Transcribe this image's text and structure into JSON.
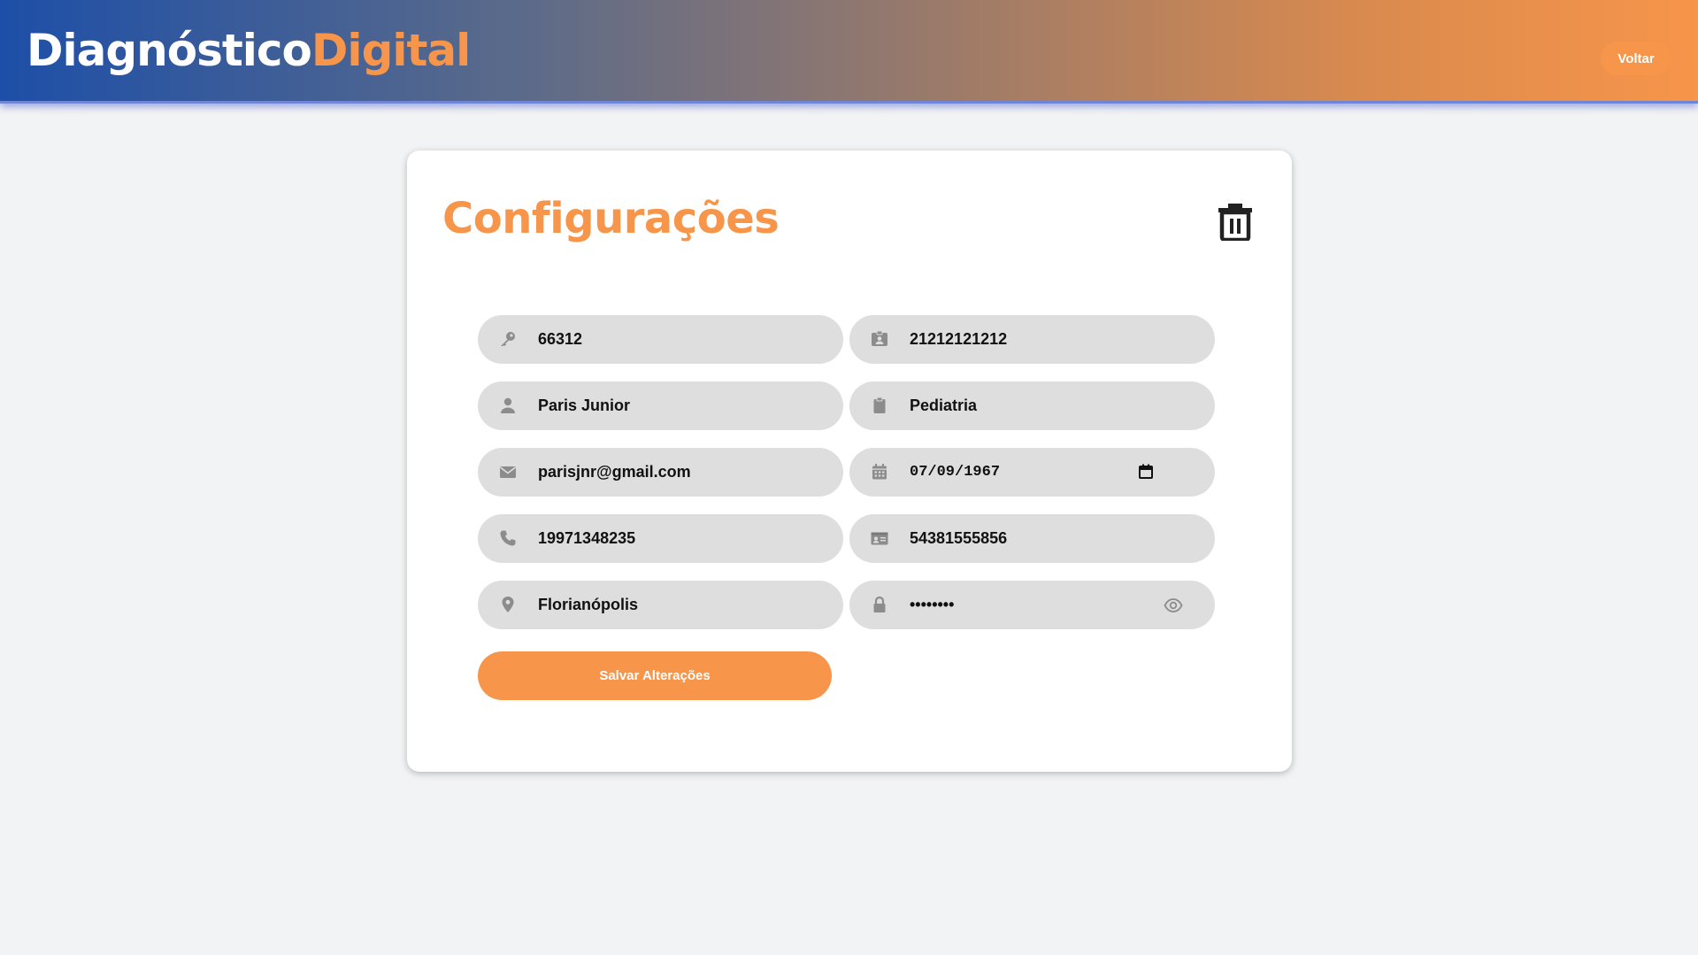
{
  "header": {
    "brand_part1": "Diagnóstico",
    "brand_part2": "Digital",
    "back_label": "Voltar"
  },
  "settings": {
    "title": "Configurações",
    "fields": {
      "crm": {
        "value": "66312",
        "icon": "key-icon"
      },
      "id_number": {
        "value": "21212121212",
        "icon": "id-badge-icon"
      },
      "name": {
        "value": "Paris Junior",
        "icon": "user-icon"
      },
      "specialty": {
        "value": "Pediatria",
        "icon": "clipboard-icon"
      },
      "email": {
        "value": "parisjnr@gmail.com",
        "icon": "envelope-icon"
      },
      "birth_date": {
        "value": "07/09/1967",
        "icon": "calendar-icon"
      },
      "phone": {
        "value": "19971348235",
        "icon": "phone-icon"
      },
      "document": {
        "value": "54381555856",
        "icon": "id-card-icon"
      },
      "city": {
        "value": "Florianópolis",
        "icon": "location-pin-icon"
      },
      "password": {
        "value": "••••••••",
        "icon": "lock-icon"
      }
    },
    "save_label": "Salvar Alterações"
  },
  "colors": {
    "accent": "#f7954a",
    "header_start": "#1d4fa8",
    "field_bg": "#dedede",
    "page_bg": "#f2f3f5"
  }
}
